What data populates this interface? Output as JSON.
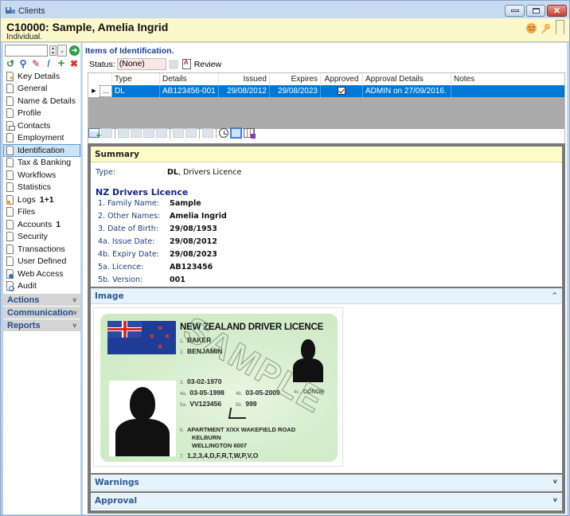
{
  "window": {
    "title": "Clients",
    "controls": {
      "minimize": "minimize",
      "maximize": "maximize",
      "close": "✕"
    }
  },
  "header": {
    "title": "C10000: Sample, Amelia Ingrid",
    "subtitle": "Individual.",
    "icons": [
      "smiley-icon",
      "key-icon",
      "bookmark-icon"
    ]
  },
  "leftnav": {
    "search": {
      "value": "",
      "placeholder": ""
    },
    "go_icon": "➜",
    "toolbar": [
      {
        "name": "history-icon",
        "glyph": "↺",
        "color": "#2e8b3e"
      },
      {
        "name": "search-icon",
        "glyph": "⚲",
        "color": "#1f5fc0"
      },
      {
        "name": "eraser-icon",
        "glyph": "✎",
        "color": "#e07b8a"
      },
      {
        "name": "pencil-icon",
        "glyph": "/",
        "color": "#2a6fd0"
      },
      {
        "name": "add-icon",
        "glyph": "+",
        "color": "#2e9b3e"
      },
      {
        "name": "delete-icon",
        "glyph": "✖",
        "color": "#d2372a"
      }
    ],
    "items": [
      {
        "label": "Key Details",
        "icon": "star",
        "count": ""
      },
      {
        "label": "General",
        "icon": "",
        "count": ""
      },
      {
        "label": "Name & Details",
        "icon": "",
        "count": ""
      },
      {
        "label": "Profile",
        "icon": "",
        "count": ""
      },
      {
        "label": "Contacts",
        "icon": "mail",
        "count": ""
      },
      {
        "label": "Employment",
        "icon": "",
        "count": ""
      },
      {
        "label": "Identification",
        "icon": "",
        "count": "",
        "active": true
      },
      {
        "label": "Tax & Banking",
        "icon": "",
        "count": ""
      },
      {
        "label": "Workflows",
        "icon": "",
        "count": ""
      },
      {
        "label": "Statistics",
        "icon": "",
        "count": ""
      },
      {
        "label": "Logs",
        "icon": "logs",
        "count": "1+1"
      },
      {
        "label": "Files",
        "icon": "",
        "count": ""
      },
      {
        "label": "Accounts",
        "icon": "",
        "count": "1"
      },
      {
        "label": "Security",
        "icon": "",
        "count": ""
      },
      {
        "label": "Transactions",
        "icon": "",
        "count": ""
      },
      {
        "label": "User Defined",
        "icon": "",
        "count": ""
      },
      {
        "label": "Web Access",
        "icon": "globe",
        "count": ""
      },
      {
        "label": "Audit",
        "icon": "audit",
        "count": ""
      }
    ],
    "sections": [
      {
        "label": "Actions",
        "chevron": "v"
      },
      {
        "label": "Communication",
        "chevron": "v"
      },
      {
        "label": "Reports",
        "chevron": "v"
      }
    ]
  },
  "main": {
    "title": "Items of Identification.",
    "status_label": "Status:",
    "status_value": "(None)",
    "review_label": "Review",
    "grid": {
      "columns": [
        "Type",
        "Details",
        "Issued",
        "Expires",
        "Approved",
        "Approval Details",
        "Notes"
      ],
      "rows": [
        {
          "indicator": "▶",
          "ellipsis": "...",
          "type": "DL",
          "details": "AB123456-001",
          "issued": "29/08/2012",
          "expires": "29/08/2023",
          "approved": true,
          "approval_details": "ADMIN on 27/09/2016.",
          "notes": ""
        }
      ]
    },
    "grid_toolbar": [
      "add-row-icon",
      "insert-icon",
      "col1-icon",
      "col2-icon",
      "col3-icon",
      "col4-icon",
      "move-up-icon",
      "move-down-icon",
      "stamp-icon",
      "clock-icon",
      "layout-icon",
      "grid-save-icon"
    ]
  },
  "summary": {
    "header": "Summary",
    "type_label": "Type:",
    "type_code": "DL",
    "type_desc": ", Drivers Licence",
    "section_title": "NZ Drivers Licence",
    "fields": [
      {
        "label": "1. Family Name:",
        "value": "Sample"
      },
      {
        "label": "2. Other Names:",
        "value": "Amelia Ingrid"
      },
      {
        "label": "3. Date of Birth:",
        "value": "29/08/1953"
      },
      {
        "label": "4a. Issue Date:",
        "value": "29/08/2012"
      },
      {
        "label": "4b. Expiry Date:",
        "value": "29/08/2023"
      },
      {
        "label": "5a. Licence:",
        "value": "AB123456"
      },
      {
        "label": "5b. Version:",
        "value": "001"
      }
    ]
  },
  "image_panel": {
    "header": "Image",
    "chevron": "^",
    "card": {
      "title": "NEW ZEALAND DRIVER LICENCE",
      "watermark": "SAMPLE",
      "lines": [
        {
          "n": "1.",
          "text": "BAKER"
        },
        {
          "n": "2.",
          "text": "BENJAMIN"
        },
        {
          "n": "3.",
          "text": "03-02-1970"
        },
        {
          "n": "4a.",
          "text": "03-05-1998"
        },
        {
          "n": "4b.",
          "text": "03-05-2009"
        },
        {
          "n": "4c.",
          "text": "DONOR"
        },
        {
          "n": "5a.",
          "text": "VV123456"
        },
        {
          "n": "5b.",
          "text": "999"
        },
        {
          "n": "6.",
          "text": "APARTMENT X/XX  WAKEFIELD ROAD"
        },
        {
          "n": "",
          "text": "KELBURN"
        },
        {
          "n": "",
          "text": "WELLINGTON 6007"
        },
        {
          "n": "7.",
          "text": "1,2,3,4,D,F,R,T,W,P,V,O"
        }
      ]
    }
  },
  "warnings_panel": {
    "header": "Warnings",
    "chevron": "v"
  },
  "approval_panel": {
    "header": "Approval",
    "chevron": "v"
  }
}
